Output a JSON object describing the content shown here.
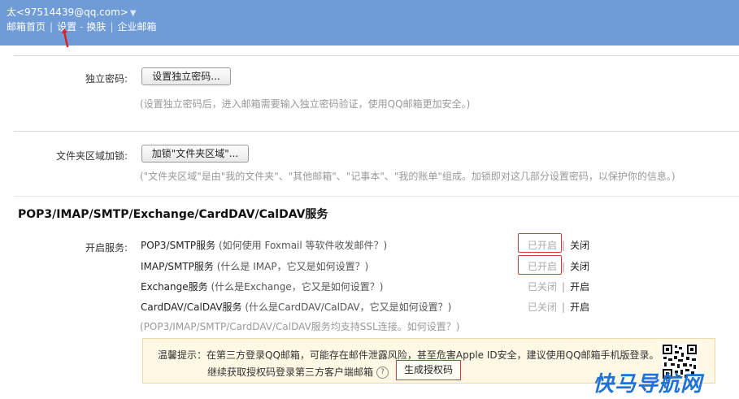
{
  "header": {
    "account": "太<97514439@qq.com>",
    "caret": "▼",
    "nav": {
      "home": "邮箱首页",
      "settings": "设置",
      "dash": "-",
      "skin": "换肤",
      "enterprise": "企业邮箱"
    },
    "sep": "|"
  },
  "independent_password": {
    "label": "独立密码:",
    "button": "设置独立密码...",
    "hint": "(设置独立密码后，进入邮箱需要输入独立密码验证，使用QQ邮箱更加安全。)"
  },
  "folder_lock": {
    "label": "文件夹区域加锁:",
    "button": "加锁\"文件夹区域\"...",
    "hint": "(\"文件夹区域\"是由\"我的文件夹\"、\"其他邮箱\"、\"记事本\"、\"我的账单\"组成。加锁即对这几部分设置密码，以保护你的信息。)"
  },
  "services": {
    "title": "POP3/IMAP/SMTP/Exchange/CardDAV/CalDAV服务",
    "label": "开启服务:",
    "items": [
      {
        "name": "POP3/SMTP服务",
        "question": "(如何使用 Foxmail 等软件收发邮件？)",
        "status": "已开启",
        "action": "关闭"
      },
      {
        "name": "IMAP/SMTP服务",
        "question": "(什么是 IMAP，它又是如何设置？)",
        "status": "已开启",
        "action": "关闭"
      },
      {
        "name": "Exchange服务",
        "question": "(什么是Exchange，它又是如何设置？)",
        "status": "已关闭",
        "action": "开启"
      },
      {
        "name": "CardDAV/CalDAV服务",
        "question": "(什么是CardDAV/CalDAV，它又是如何设置？)",
        "status": "已关闭",
        "action": "开启"
      }
    ],
    "ssl_note": "(POP3/IMAP/SMTP/CardDAV/CalDAV服务均支持SSL连接。如何设置？)"
  },
  "tip": {
    "line1": "温馨提示：在第三方登录QQ邮箱，可能存在邮件泄露风险，甚至危害Apple ID安全，建议使用QQ邮箱手机版登录。",
    "line2": "继续获取授权码登录第三方客户端邮箱",
    "qmark": "?",
    "generate_button": "生成授权码"
  },
  "watermark": "快马导航网",
  "colors": {
    "header_bg": "#6f9bd6",
    "highlight": "#d9383a",
    "tip_bg": "#fff8e5",
    "watermark": "#1f73d6"
  }
}
